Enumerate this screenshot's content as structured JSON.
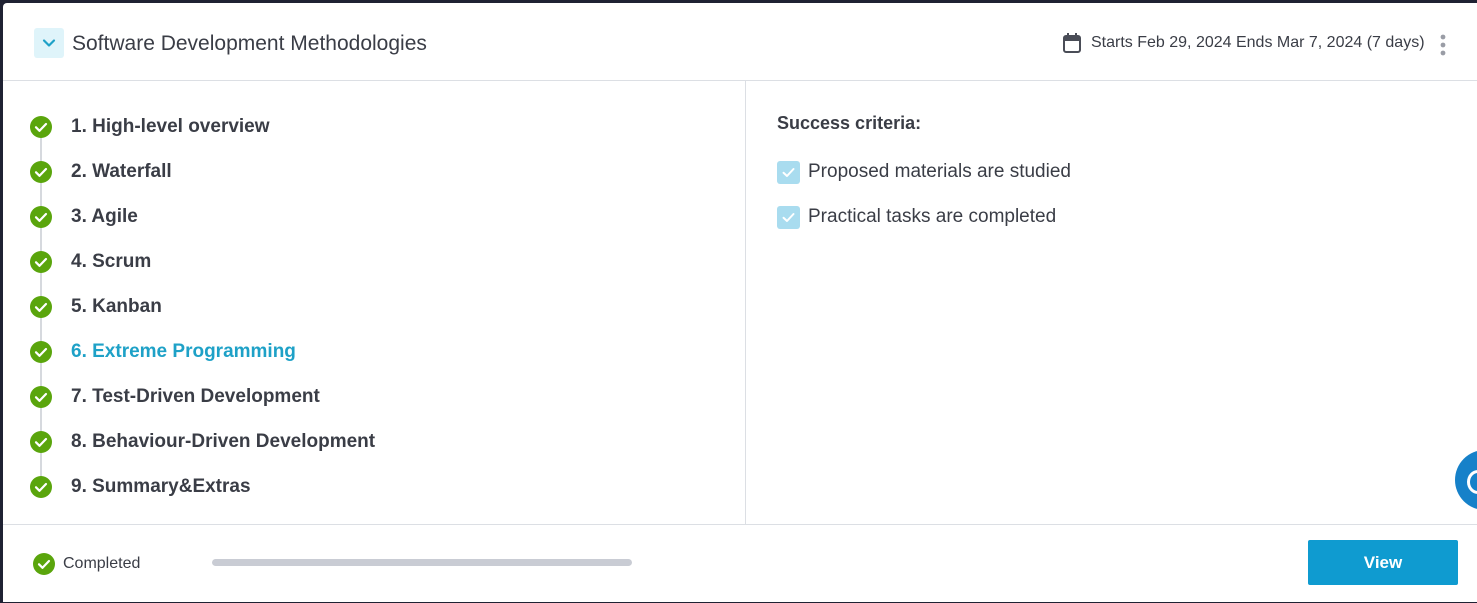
{
  "header": {
    "title": "Software Development Methodologies",
    "dates": "Starts Feb 29, 2024 Ends Mar 7, 2024 (7 days)",
    "collapse_icon": "chevron-down-icon",
    "calendar_icon": "calendar-icon",
    "menu_icon": "kebab-menu-icon"
  },
  "steps": [
    {
      "label": "1. High-level overview",
      "done": true,
      "active": false
    },
    {
      "label": "2. Waterfall",
      "done": true,
      "active": false
    },
    {
      "label": "3. Agile",
      "done": true,
      "active": false
    },
    {
      "label": "4. Scrum",
      "done": true,
      "active": false
    },
    {
      "label": "5. Kanban",
      "done": true,
      "active": false
    },
    {
      "label": "6. Extreme Programming",
      "done": true,
      "active": true
    },
    {
      "label": "7. Test-Driven Development",
      "done": true,
      "active": false
    },
    {
      "label": "8. Behaviour-Driven Development",
      "done": true,
      "active": false
    },
    {
      "label": "9. Summary&Extras",
      "done": true,
      "active": false
    }
  ],
  "criteria": {
    "title": "Success criteria:",
    "items": [
      {
        "label": "Proposed materials are studied",
        "checked": true
      },
      {
        "label": "Practical tasks are completed",
        "checked": true
      }
    ]
  },
  "footer": {
    "status": "Completed",
    "progress": 1.0,
    "view_label": "View"
  },
  "colors": {
    "accent": "#0f9bd0",
    "active_step": "#1ea1c7",
    "check_green": "#5aa50c",
    "text": "#3a3d46"
  }
}
